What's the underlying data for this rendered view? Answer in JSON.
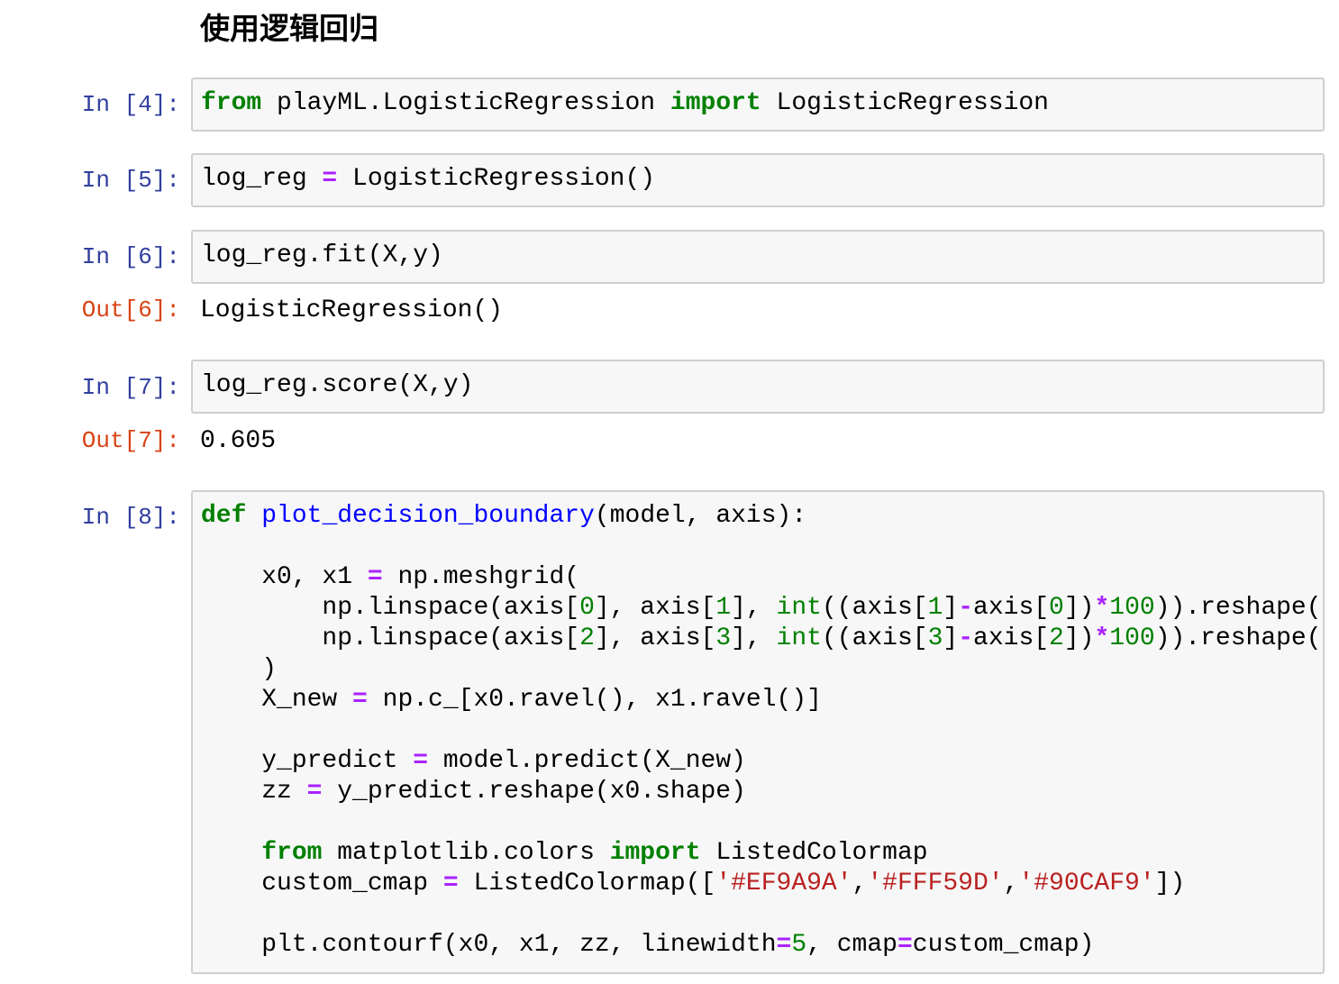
{
  "heading": "使用逻辑回归",
  "cells": [
    {
      "prompt": "In [4]:",
      "tokens": [
        [
          [
            "kw",
            "from"
          ],
          [
            "",
            " playML.LogisticRegression "
          ],
          [
            "kw",
            "import"
          ],
          [
            "",
            " LogisticRegression"
          ]
        ]
      ]
    },
    {
      "prompt": "In [5]:",
      "tokens": [
        [
          [
            "",
            "log_reg "
          ],
          [
            "op",
            "="
          ],
          [
            "",
            " LogisticRegression()"
          ]
        ]
      ]
    },
    {
      "prompt": "In [6]:",
      "tokens": [
        [
          [
            "",
            "log_reg.fit(X,y)"
          ]
        ]
      ],
      "out_prompt": "Out[6]:",
      "output": "LogisticRegression()"
    },
    {
      "prompt": "In [7]:",
      "tokens": [
        [
          [
            "",
            "log_reg.score(X,y)"
          ]
        ]
      ],
      "out_prompt": "Out[7]:",
      "output": "0.605"
    },
    {
      "prompt": "In [8]:",
      "tokens": [
        [
          [
            "kw",
            "def"
          ],
          [
            "",
            " "
          ],
          [
            "nf",
            "plot_decision_boundary"
          ],
          [
            "",
            "(model, axis):"
          ]
        ],
        [],
        [
          [
            "",
            "    x0, x1 "
          ],
          [
            "op",
            "="
          ],
          [
            "",
            " np.meshgrid("
          ]
        ],
        [
          [
            "",
            "        np.linspace(axis["
          ],
          [
            "num",
            "0"
          ],
          [
            "",
            "], axis["
          ],
          [
            "num",
            "1"
          ],
          [
            "",
            "], "
          ],
          [
            "bi",
            "int"
          ],
          [
            "",
            "((axis["
          ],
          [
            "num",
            "1"
          ],
          [
            "",
            "]"
          ],
          [
            "op",
            "-"
          ],
          [
            "",
            "axis["
          ],
          [
            "num",
            "0"
          ],
          [
            "",
            "])"
          ],
          [
            "op",
            "*"
          ],
          [
            "num",
            "100"
          ],
          [
            "",
            ")).reshape("
          ],
          [
            "op",
            "-"
          ],
          [
            "num",
            "1"
          ],
          [
            "",
            ", "
          ],
          [
            "num",
            "1"
          ],
          [
            "",
            ")),"
          ]
        ],
        [
          [
            "",
            "        np.linspace(axis["
          ],
          [
            "num",
            "2"
          ],
          [
            "",
            "], axis["
          ],
          [
            "num",
            "3"
          ],
          [
            "",
            "], "
          ],
          [
            "bi",
            "int"
          ],
          [
            "",
            "((axis["
          ],
          [
            "num",
            "3"
          ],
          [
            "",
            "]"
          ],
          [
            "op",
            "-"
          ],
          [
            "",
            "axis["
          ],
          [
            "num",
            "2"
          ],
          [
            "",
            "])"
          ],
          [
            "op",
            "*"
          ],
          [
            "num",
            "100"
          ],
          [
            "",
            ")).reshape("
          ],
          [
            "op",
            "-"
          ],
          [
            "num",
            "1"
          ],
          [
            "",
            ", "
          ],
          [
            "num",
            "1"
          ],
          [
            "",
            ")),"
          ]
        ],
        [
          [
            "",
            "    )"
          ]
        ],
        [
          [
            "",
            "    X_new "
          ],
          [
            "op",
            "="
          ],
          [
            "",
            " np.c_[x0.ravel(), x1.ravel()]"
          ]
        ],
        [],
        [
          [
            "",
            "    y_predict "
          ],
          [
            "op",
            "="
          ],
          [
            "",
            " model.predict(X_new)"
          ]
        ],
        [
          [
            "",
            "    zz "
          ],
          [
            "op",
            "="
          ],
          [
            "",
            " y_predict.reshape(x0.shape)"
          ]
        ],
        [],
        [
          [
            "",
            "    "
          ],
          [
            "kw",
            "from"
          ],
          [
            "",
            " matplotlib.colors "
          ],
          [
            "kw",
            "import"
          ],
          [
            "",
            " ListedColormap"
          ]
        ],
        [
          [
            "",
            "    custom_cmap "
          ],
          [
            "op",
            "="
          ],
          [
            "",
            " ListedColormap(["
          ],
          [
            "str",
            "'#EF9A9A'"
          ],
          [
            "",
            ","
          ],
          [
            "str",
            "'#FFF59D'"
          ],
          [
            "",
            ","
          ],
          [
            "str",
            "'#90CAF9'"
          ],
          [
            "",
            "])"
          ]
        ],
        [],
        [
          [
            "",
            "    plt.contourf(x0, x1, zz, linewidth"
          ],
          [
            "op",
            "="
          ],
          [
            "num",
            "5"
          ],
          [
            "",
            ", cmap"
          ],
          [
            "op",
            "="
          ],
          [
            "",
            "custom_cmap)"
          ]
        ]
      ]
    }
  ]
}
